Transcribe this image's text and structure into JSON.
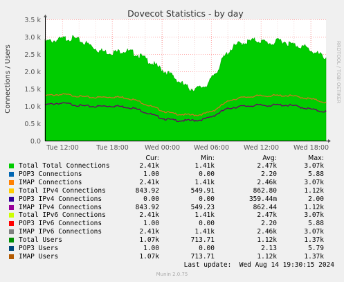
{
  "chart_data": {
    "type": "area",
    "title": "Dovecot Statistics - by day",
    "ylabel": "Connections / Users",
    "side_label": "RRDTOOL / TOBI OETIKER",
    "ylim": [
      0,
      3500
    ],
    "y_ticks": [
      0,
      500,
      1000,
      1500,
      2000,
      2500,
      3000,
      3500
    ],
    "y_tick_labels": [
      "0.0",
      "0.5 k",
      "1.0 k",
      "1.5 k",
      "2.0 k",
      "2.5 k",
      "3.0 k",
      "3.5 k"
    ],
    "x_ticks": [
      11.625,
      17.625,
      23.625,
      29.625,
      35.625,
      41.625
    ],
    "x_tick_labels": [
      "Tue 12:00",
      "Tue 18:00",
      "Wed 00:00",
      "Wed 06:00",
      "Wed 12:00",
      "Wed 18:00"
    ],
    "xlim": [
      9.5,
      43.5
    ],
    "grid": true,
    "colors": {
      "total": "#00cc00",
      "imap_users": "#cc7722",
      "total_users": "#660066",
      "plot_bg": "#ffffff",
      "grid": "#ffaaaa"
    },
    "series": [
      {
        "name": "Total Connections",
        "color": "#00cc00",
        "x": [
          9.5,
          11,
          12,
          13,
          14,
          15,
          16,
          17,
          18,
          19,
          20,
          21,
          22,
          23,
          24,
          25,
          26,
          27,
          28,
          29,
          29.5,
          30,
          30.5,
          31,
          32,
          33,
          34,
          35,
          36,
          37,
          38,
          39,
          40,
          41,
          42,
          43,
          43.5
        ],
        "values": [
          2850,
          2900,
          2950,
          2950,
          2850,
          2750,
          2600,
          2550,
          2550,
          2600,
          2550,
          2450,
          2300,
          2150,
          2000,
          1850,
          1650,
          1500,
          1500,
          1600,
          1720,
          1920,
          2080,
          2350,
          2650,
          2800,
          2850,
          2900,
          2850,
          2800,
          2900,
          2800,
          2750,
          2700,
          2550,
          2450,
          2400
        ]
      },
      {
        "name": "IMAP Users",
        "color": "#cc7722",
        "x": [
          9.5,
          11,
          12,
          13,
          14,
          15,
          16,
          17,
          18,
          19,
          20,
          21,
          22,
          23,
          24,
          25,
          26,
          27,
          28,
          29,
          30,
          31,
          32,
          33,
          34,
          35,
          36,
          37,
          38,
          39,
          40,
          41,
          42,
          43,
          43.5
        ],
        "values": [
          1300,
          1330,
          1330,
          1300,
          1270,
          1250,
          1250,
          1260,
          1260,
          1250,
          1200,
          1120,
          1020,
          930,
          840,
          780,
          760,
          740,
          740,
          790,
          880,
          1040,
          1180,
          1230,
          1260,
          1290,
          1290,
          1300,
          1300,
          1300,
          1270,
          1230,
          1190,
          1130,
          1090
        ]
      },
      {
        "name": "Total Users",
        "color": "#660066",
        "x": [
          9.5,
          11,
          12,
          13,
          14,
          15,
          16,
          17,
          18,
          19,
          20,
          21,
          22,
          23,
          24,
          25,
          26,
          27,
          28,
          29,
          30,
          31,
          32,
          33,
          34,
          35,
          36,
          37,
          38,
          39,
          40,
          41,
          42,
          43,
          43.5
        ],
        "values": [
          1030,
          1080,
          1070,
          1040,
          1000,
          990,
          990,
          1000,
          1000,
          980,
          950,
          880,
          790,
          700,
          630,
          590,
          580,
          580,
          590,
          630,
          730,
          860,
          950,
          980,
          1000,
          1020,
          1020,
          1020,
          1030,
          1020,
          990,
          940,
          890,
          850,
          840
        ]
      }
    ],
    "legend_headers": {
      "cur": "Cur:",
      "min": "Min:",
      "avg": "Avg:",
      "max": "Max:"
    },
    "legend": [
      {
        "name": "Total Connections",
        "color": "#00cc00",
        "cur": "2.41k",
        "min": "1.41k",
        "avg": "2.47k",
        "max": "3.07k"
      },
      {
        "name": "POP3 Connections",
        "color": "#0066b3",
        "cur": "1.00",
        "min": "0.00",
        "avg": "2.20",
        "max": "5.88"
      },
      {
        "name": "IMAP Connections",
        "color": "#ff8000",
        "cur": "2.41k",
        "min": "1.41k",
        "avg": "2.46k",
        "max": "3.07k"
      },
      {
        "name": "IPv4 Connections",
        "color": "#ffcc00",
        "cur": "843.92",
        "min": "549.91",
        "avg": "862.80",
        "max": "1.12k"
      },
      {
        "name": "POP3 IPv4 Connections",
        "color": "#330099",
        "cur": "0.00",
        "min": "0.00",
        "avg": "359.44m",
        "max": "2.00"
      },
      {
        "name": "IMAP IPv4 Connections",
        "color": "#990099",
        "cur": "843.92",
        "min": "549.23",
        "avg": "862.44",
        "max": "1.12k"
      },
      {
        "name": "IPv6 Connections",
        "color": "#ccff00",
        "cur": "2.41k",
        "min": "1.41k",
        "avg": "2.47k",
        "max": "3.07k"
      },
      {
        "name": "POP3 IPv6 Connections",
        "color": "#ff0000",
        "cur": "1.00",
        "min": "0.00",
        "avg": "2.20",
        "max": "5.88"
      },
      {
        "name": "IMAP IPv6 Connections",
        "color": "#808080",
        "cur": "2.41k",
        "min": "1.41k",
        "avg": "2.46k",
        "max": "3.07k"
      },
      {
        "name": "Users",
        "color": "#008f00",
        "cur": "1.07k",
        "min": "713.71",
        "avg": "1.12k",
        "max": "1.37k"
      },
      {
        "name": "POP3 Users",
        "color": "#00487d",
        "cur": "1.00",
        "min": "0.00",
        "avg": "2.13",
        "max": "5.79"
      },
      {
        "name": "IMAP Users",
        "color": "#b35a00",
        "cur": "1.07k",
        "min": "713.71",
        "avg": "1.12k",
        "max": "1.37k"
      }
    ],
    "legend_prefix": "Total ",
    "legend_prefixed": [
      0,
      3,
      6,
      9
    ],
    "last_update": "Last update:  Wed Aug 14 19:30:15 2024",
    "footer": "Munin 2.0.75"
  }
}
